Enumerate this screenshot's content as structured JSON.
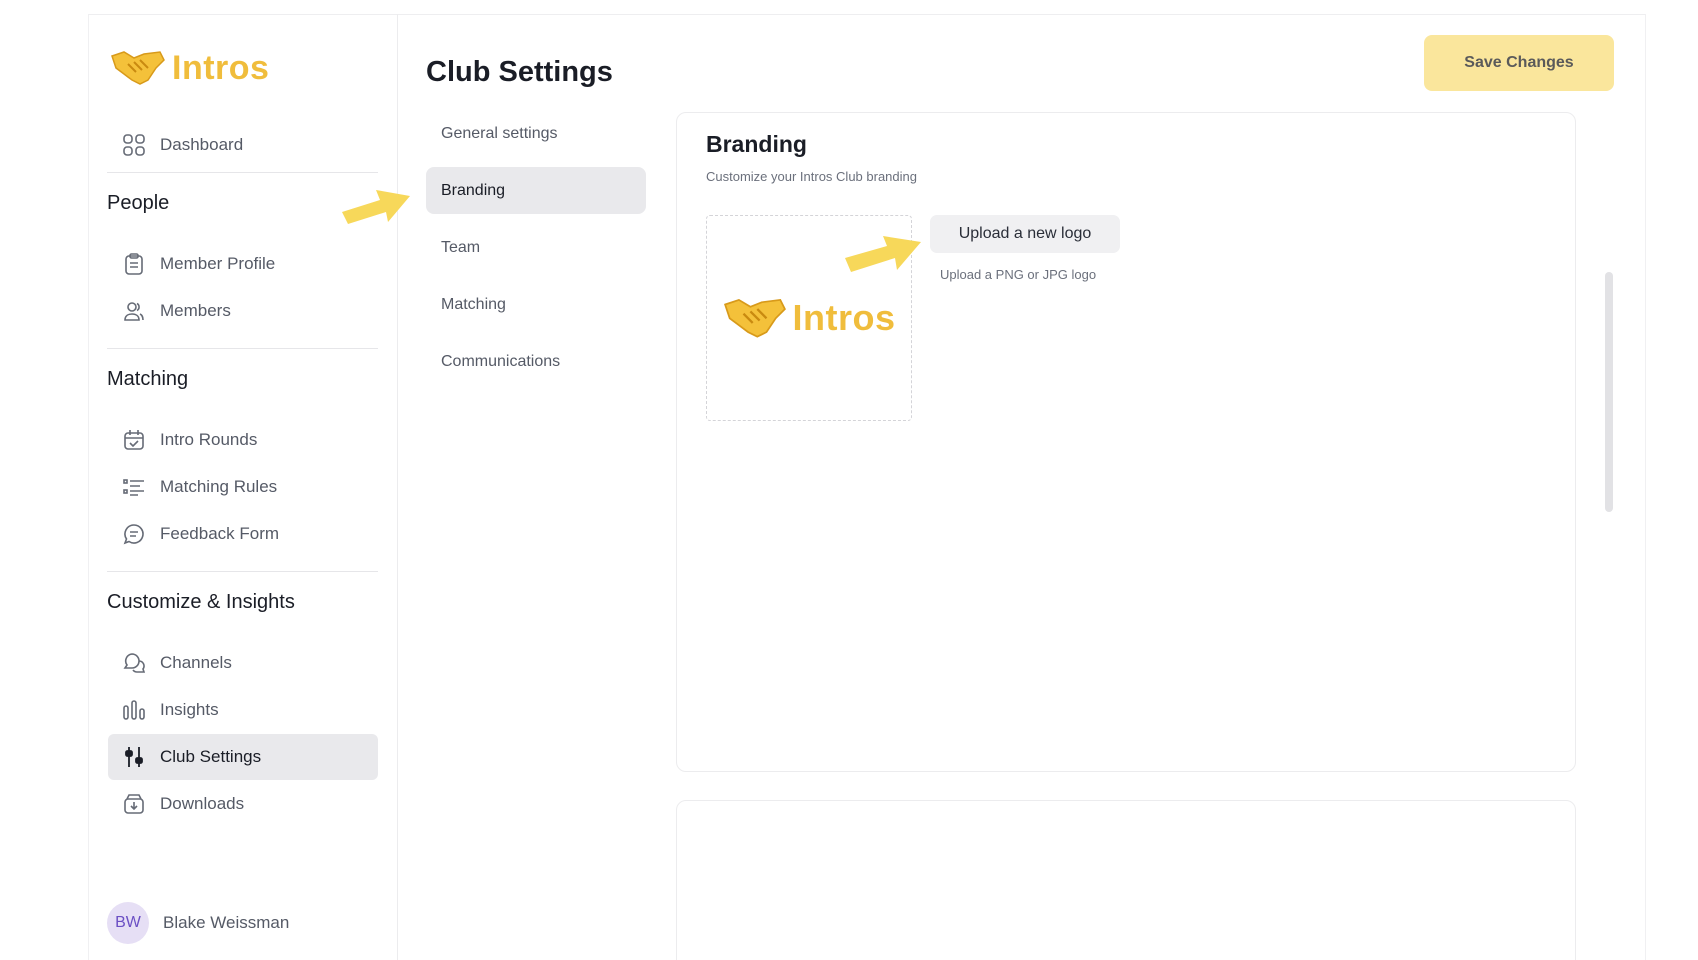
{
  "app": {
    "name": "Intros"
  },
  "sidebar": {
    "dashboard": "Dashboard",
    "sections": {
      "people": "People",
      "matching": "Matching",
      "customize": "Customize & Insights"
    },
    "items": {
      "member_profile": "Member Profile",
      "members": "Members",
      "intro_rounds": "Intro Rounds",
      "matching_rules": "Matching Rules",
      "feedback_form": "Feedback Form",
      "channels": "Channels",
      "insights": "Insights",
      "club_settings": "Club Settings",
      "downloads": "Downloads"
    },
    "user": {
      "initials": "BW",
      "name": "Blake Weissman"
    }
  },
  "main": {
    "title": "Club Settings",
    "save_label": "Save Changes",
    "subnav": [
      "General settings",
      "Branding",
      "Team",
      "Matching",
      "Communications"
    ],
    "active_subnav": "Branding"
  },
  "branding": {
    "title": "Branding",
    "subtitle": "Customize your Intros Club branding",
    "upload_label": "Upload a new logo",
    "upload_hint": "Upload a PNG or JPG logo",
    "logo_text": "Intros"
  },
  "colors": {
    "brand": "#f0bd3c",
    "save_button": "#fae69c",
    "arrow": "#f7d85a",
    "active_bg": "#e9e9ec"
  }
}
